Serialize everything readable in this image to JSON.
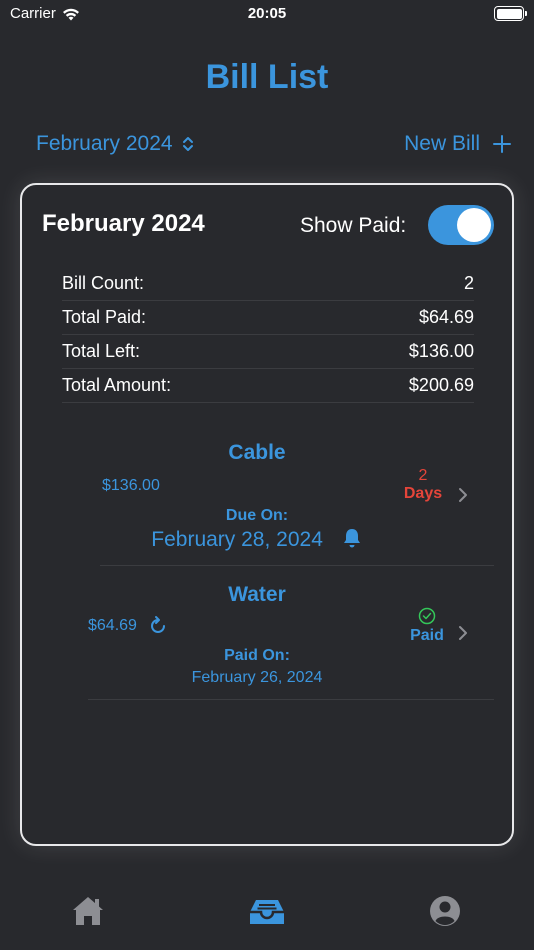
{
  "status_bar": {
    "carrier": "Carrier",
    "time": "20:05"
  },
  "title": "Bill List",
  "toolbar": {
    "month_label": "February 2024",
    "new_bill_label": "New Bill"
  },
  "card": {
    "month": "February 2024",
    "show_paid_label": "Show Paid:",
    "show_paid_on": true,
    "summary": [
      {
        "label": "Bill Count:",
        "value": "2"
      },
      {
        "label": "Total Paid:",
        "value": "$64.69"
      },
      {
        "label": "Total Left:",
        "value": "$136.00"
      },
      {
        "label": "Total Amount:",
        "value": "$200.69"
      }
    ],
    "bills": [
      {
        "name": "Cable",
        "amount": "$136.00",
        "status_top": "2",
        "status_bottom": "Days",
        "date_label": "Due On:",
        "date": "February 28, 2024"
      },
      {
        "name": "Water",
        "amount": "$64.69",
        "status_bottom": "Paid",
        "date_label": "Paid On:",
        "date": "February 26, 2024"
      }
    ]
  },
  "colors": {
    "accent": "#3b95dd",
    "due_red": "#e5453a",
    "paid_green": "#34c759",
    "background": "#28292d"
  },
  "tabs": [
    {
      "icon": "home-icon",
      "active": false
    },
    {
      "icon": "tray-icon",
      "active": true
    },
    {
      "icon": "profile-icon",
      "active": false
    }
  ]
}
